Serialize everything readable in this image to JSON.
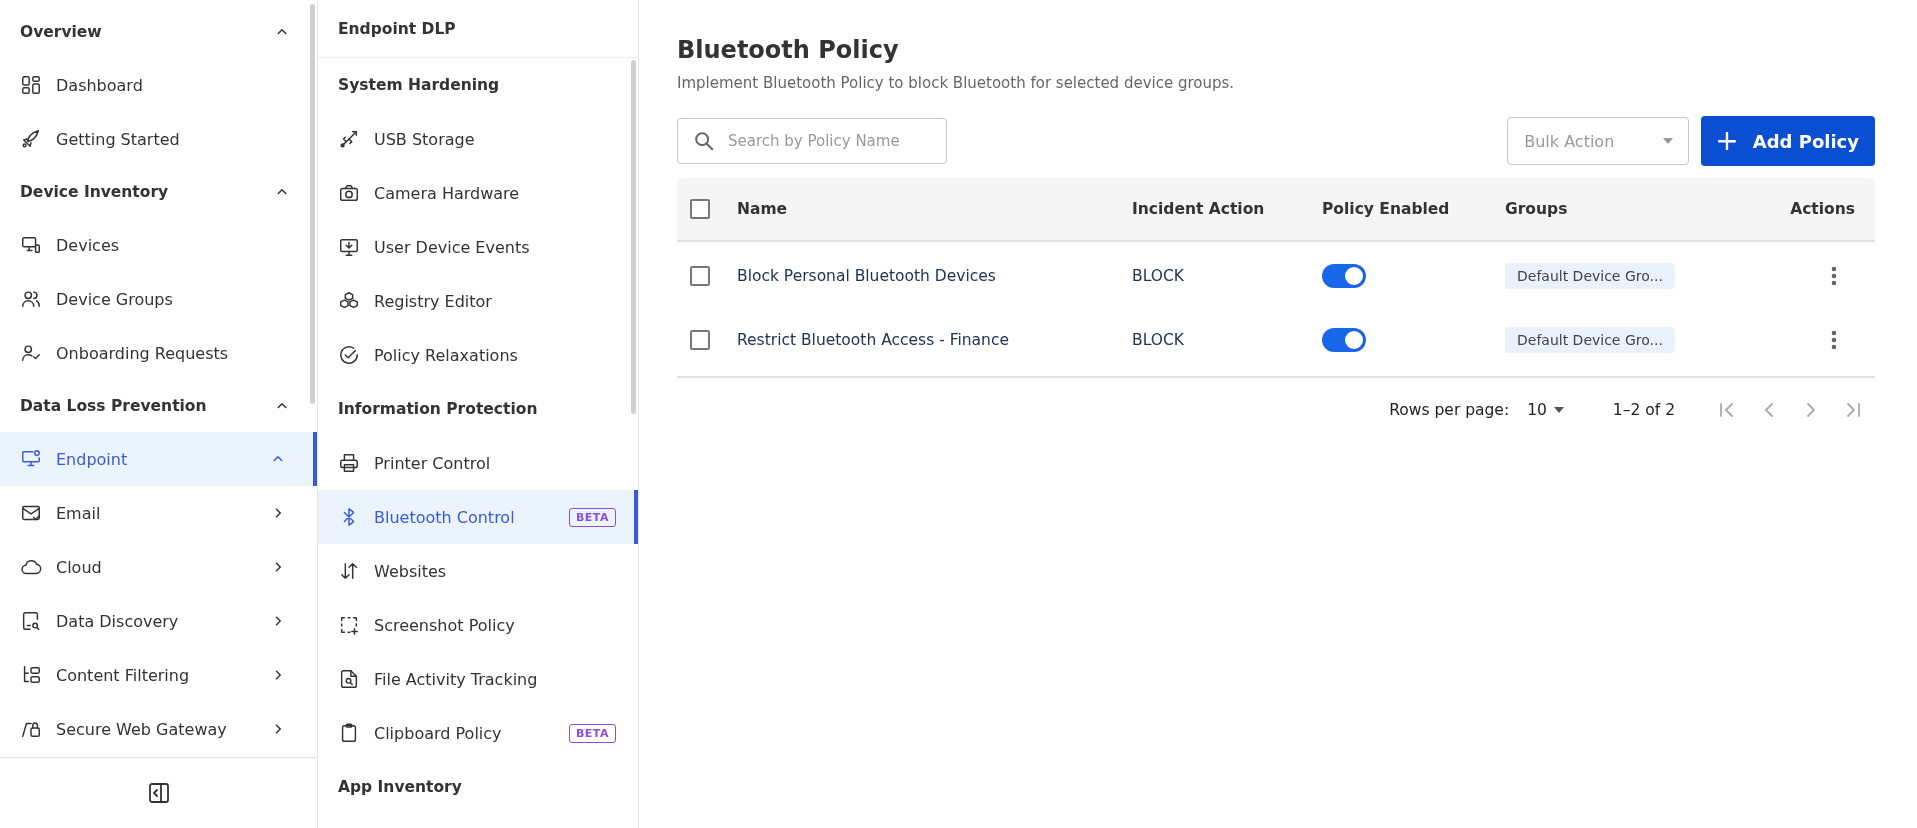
{
  "sidebar": {
    "sections": [
      {
        "title": "Overview",
        "expanded": true,
        "items": [
          {
            "label": "Dashboard",
            "selected": false
          },
          {
            "label": "Getting Started",
            "selected": false
          }
        ]
      },
      {
        "title": "Device Inventory",
        "expanded": true,
        "items": [
          {
            "label": "Devices",
            "selected": false
          },
          {
            "label": "Device Groups",
            "selected": false
          },
          {
            "label": "Onboarding Requests",
            "selected": false
          }
        ]
      },
      {
        "title": "Data Loss Prevention",
        "expanded": true,
        "items": [
          {
            "label": "Endpoint",
            "selected": true,
            "expanded": true
          },
          {
            "label": "Email",
            "selected": false,
            "expanded": false
          },
          {
            "label": "Cloud",
            "selected": false,
            "expanded": false
          },
          {
            "label": "Data Discovery",
            "selected": false,
            "expanded": false
          },
          {
            "label": "Content Filtering",
            "selected": false,
            "expanded": false
          },
          {
            "label": "Secure Web Gateway",
            "selected": false,
            "expanded": false
          }
        ]
      }
    ]
  },
  "subnav": {
    "title": "Endpoint DLP",
    "sections": [
      {
        "title": "System Hardening",
        "items": [
          {
            "label": "USB Storage",
            "selected": false
          },
          {
            "label": "Camera Hardware",
            "selected": false
          },
          {
            "label": "User Device Events",
            "selected": false
          },
          {
            "label": "Registry Editor",
            "selected": false
          },
          {
            "label": "Policy Relaxations",
            "selected": false
          }
        ]
      },
      {
        "title": "Information Protection",
        "items": [
          {
            "label": "Printer Control",
            "selected": false
          },
          {
            "label": "Bluetooth Control",
            "selected": true,
            "badge": "BETA"
          },
          {
            "label": "Websites",
            "selected": false
          },
          {
            "label": "Screenshot Policy",
            "selected": false
          },
          {
            "label": "File Activity Tracking",
            "selected": false
          },
          {
            "label": "Clipboard Policy",
            "selected": false,
            "badge": "BETA"
          }
        ]
      },
      {
        "title": "App Inventory"
      }
    ]
  },
  "page": {
    "title": "Bluetooth Policy",
    "subtitle": "Implement Bluetooth Policy to block Bluetooth for selected device groups."
  },
  "search": {
    "placeholder": "Search by Policy Name"
  },
  "bulk_action": {
    "placeholder": "Bulk Action"
  },
  "add_button": {
    "icon": "+",
    "label": "Add Policy"
  },
  "table": {
    "select_all": false,
    "columns": [
      "Name",
      "Incident Action",
      "Policy Enabled",
      "Groups",
      "Actions"
    ],
    "rows": [
      {
        "checked": false,
        "name": "Block Personal Bluetooth Devices",
        "action": "BLOCK",
        "enabled": true,
        "group": "Default Device Gro..."
      },
      {
        "checked": false,
        "name": "Restrict Bluetooth Access - Finance",
        "action": "BLOCK",
        "enabled": true,
        "group": "Default Device Gro..."
      }
    ]
  },
  "pagination": {
    "rows_label": "Rows per page:",
    "rows_value": "10",
    "range": "1–2 of 2"
  }
}
